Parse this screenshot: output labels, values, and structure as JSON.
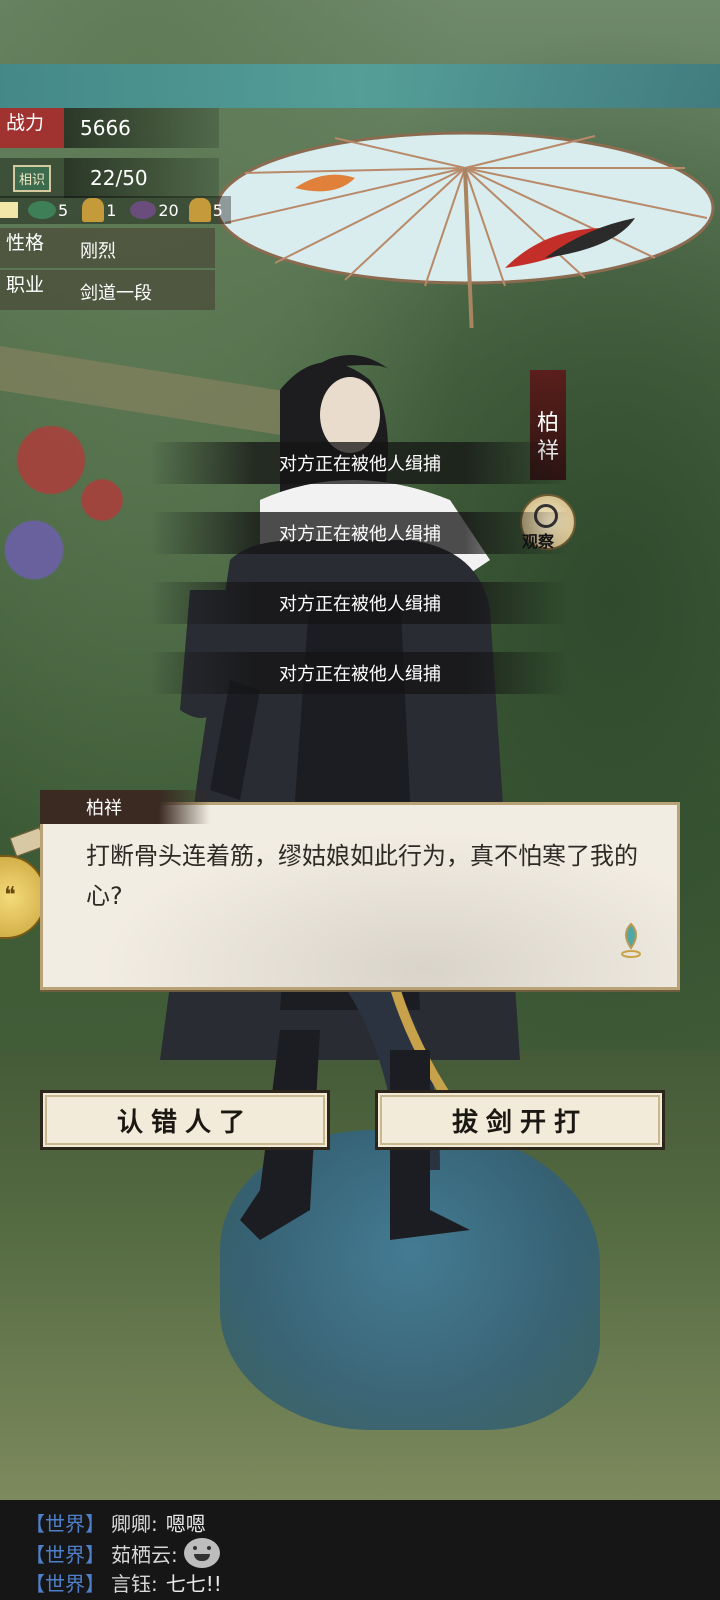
{
  "stats": {
    "combat_label": "战力",
    "combat_value": "5666",
    "acquaint_label": "相识",
    "acquaint_value": "22/50"
  },
  "resources": [
    {
      "icon": "jade-icon",
      "count": "5"
    },
    {
      "icon": "gold-ore-icon",
      "count": "1"
    },
    {
      "icon": "pouch-icon",
      "count": "20"
    },
    {
      "icon": "gold-ore-icon",
      "count": "5"
    }
  ],
  "traits": [
    {
      "label": "性格",
      "value": "刚烈"
    },
    {
      "label": "职业",
      "value": "剑道一段"
    }
  ],
  "npc": {
    "name": "柏祥",
    "observe_label": "观察"
  },
  "notifications": [
    "对方正在被他人缉捕",
    "对方正在被他人缉捕",
    "对方正在被他人缉捕",
    "对方正在被他人缉捕"
  ],
  "dialog": {
    "speaker": "柏祥",
    "text": "打断骨头连着筋，缪姑娘如此行为，真不怕寒了我的心?"
  },
  "choices": {
    "left": "认错人了",
    "right": "拔剑开打"
  },
  "chat": [
    {
      "channel": "【世界】",
      "name": "卿卿:",
      "message": "嗯嗯"
    },
    {
      "channel": "【世界】",
      "name": "茹栖云:",
      "message": ""
    },
    {
      "channel": "【世界】",
      "name": "言钰:",
      "message": "七七!!"
    }
  ],
  "colors": {
    "accent_red": "#a0322f",
    "chat_channel": "#4e7fc9"
  }
}
